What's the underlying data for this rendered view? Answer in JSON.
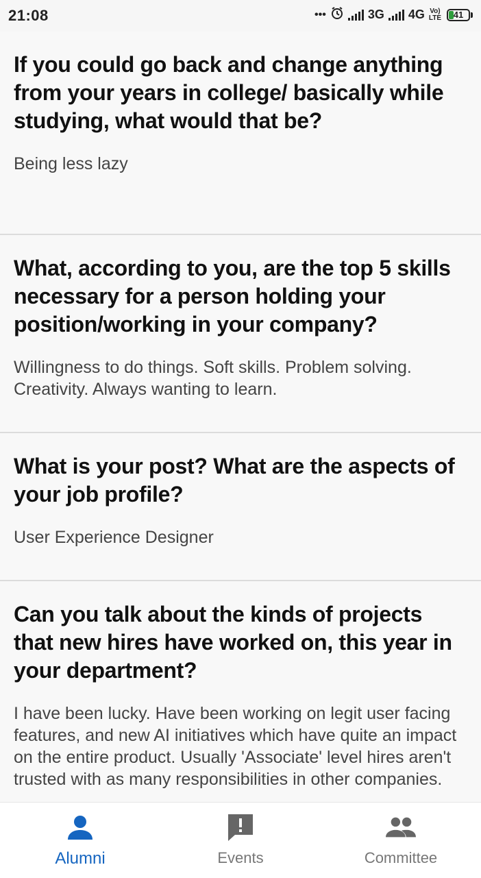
{
  "status_bar": {
    "time": "21:08",
    "dots": "•••",
    "network_1": "3G",
    "network_2": "4G",
    "volte_top": "Vo)",
    "volte_bottom": "LTE",
    "battery_level": "41"
  },
  "cards": [
    {
      "question": "If you could go back and change anything from your years in college/ basically while studying, what would that be?",
      "answer": "Being less lazy"
    },
    {
      "question": "What, according to you, are the top 5 skills necessary for a person holding your position/working in your company?",
      "answer": "Willingness to do things. Soft skills. Problem solving. Creativity. Always wanting to learn."
    },
    {
      "question": "What is your post? What are the aspects of your job profile?",
      "answer": "User Experience Designer"
    },
    {
      "question": "Can you talk about the kinds of projects that new hires have worked on, this year in your department?",
      "answer": "I have been lucky. Have been working on legit user facing features, and new AI initiatives which have quite an impact on the entire product. Usually 'Associate' level hires aren't trusted with as many responsibilities in other companies."
    }
  ],
  "bottom_nav": {
    "items": [
      {
        "label": "Alumni",
        "icon": "person-icon",
        "active": true
      },
      {
        "label": "Events",
        "icon": "alert-message-icon",
        "active": false
      },
      {
        "label": "Committee",
        "icon": "group-icon",
        "active": false
      }
    ]
  },
  "colors": {
    "accent": "#1565c0",
    "inactive": "#777777",
    "battery": "#2e9e3c"
  }
}
